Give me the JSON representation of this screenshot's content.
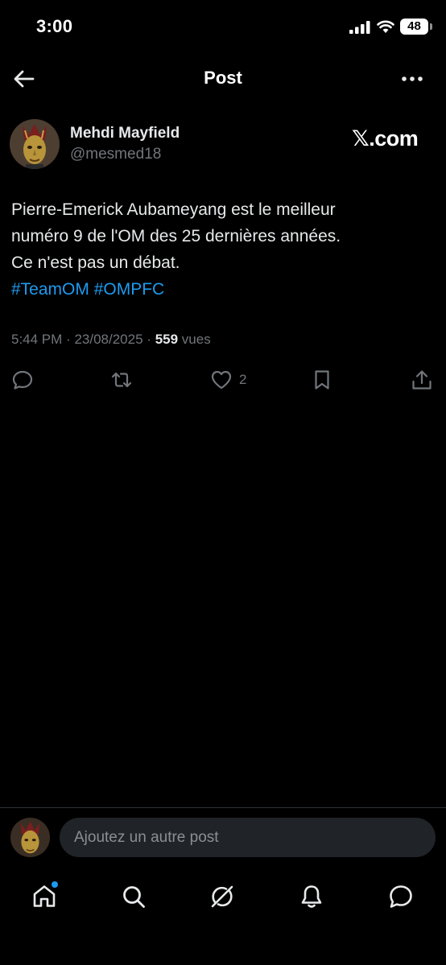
{
  "status_bar": {
    "time": "3:00",
    "battery": "48"
  },
  "header": {
    "title": "Post"
  },
  "author": {
    "name": "Mehdi Mayfield",
    "handle": "@mesmed18",
    "watermark": "𝕏.com"
  },
  "tweet": {
    "lines": [
      "Pierre-Emerick Aubameyang est le meilleur",
      "numéro 9 de l'OM des 25 dernières années.",
      "Ce n'est pas un débat."
    ],
    "hashtags": [
      "#TeamOM",
      "#OMPFC"
    ],
    "time": "5:44 PM",
    "date": "23/08/2025",
    "separator": "·",
    "views_count": "559",
    "views_label": "vues"
  },
  "actions": {
    "like_count": "2"
  },
  "reply": {
    "placeholder": "Ajoutez un autre post"
  },
  "icons": {
    "back": "arrow-left-icon",
    "more": "more-dots-icon",
    "reply": "comment-icon",
    "repost": "repost-icon",
    "like": "heart-icon",
    "bookmark": "bookmark-icon",
    "share": "share-icon",
    "home": "home-icon",
    "search": "search-icon",
    "grok": "grok-icon",
    "notifications": "bell-icon",
    "messages": "message-icon"
  },
  "colors": {
    "accent": "#1d9bf0",
    "background": "#000000",
    "secondary_text": "#71767b"
  }
}
